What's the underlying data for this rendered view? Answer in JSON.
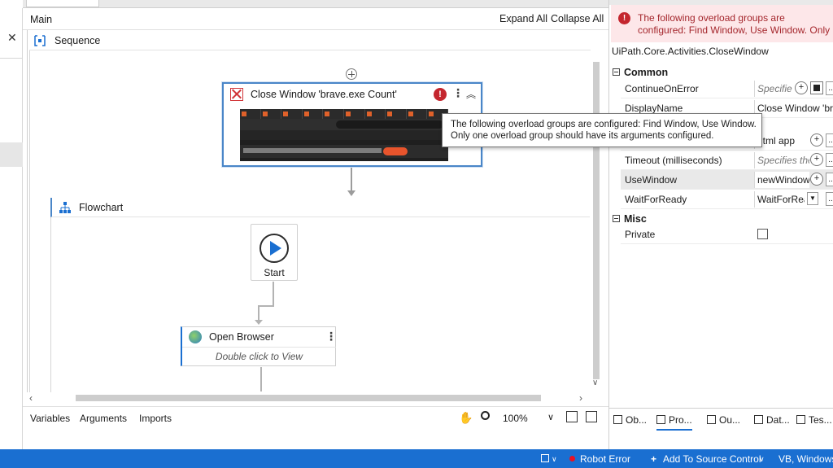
{
  "designer": {
    "breadcrumb": "Main",
    "expand_all": "Expand All",
    "collapse_all": "Collapse All",
    "sequence_label": "Sequence",
    "flowchart_label": "Flowchart"
  },
  "close_window": {
    "title": "Close Window 'brave.exe Count'"
  },
  "flowchart": {
    "start_label": "Start",
    "open_browser_title": "Open Browser",
    "open_browser_hint": "Double click to View"
  },
  "tooltip": {
    "text": "The following overload groups are configured: Find Window, Use Window. Only one overload group should have its arguments configured."
  },
  "footer": {
    "variables": "Variables",
    "arguments": "Arguments",
    "imports": "Imports",
    "zoom": "100%"
  },
  "properties": {
    "error_text": "The following overload groups are configured: Find Window, Use Window. Only one overlo...",
    "type_name": "UiPath.Core.Activities.CloseWindow",
    "categories": {
      "common": "Common",
      "misc": "Misc"
    },
    "rows": {
      "continue_on_error": {
        "name": "ContinueOnError",
        "value": "Specifie"
      },
      "display_name": {
        "name": "DisplayName",
        "value": "Close Window 'brav"
      },
      "row3_value": "html app",
      "timeout": {
        "name": "Timeout (milliseconds)",
        "value": "Specifies the"
      },
      "use_window": {
        "name": "UseWindow",
        "value": "newWindow"
      },
      "wait_for_ready": {
        "name": "WaitForReady",
        "value": "WaitForRea"
      },
      "private": {
        "name": "Private"
      }
    },
    "tabs": [
      "Ob...",
      "Pro...",
      "Ou...",
      "Dat...",
      "Tes..."
    ]
  },
  "statusbar": {
    "robot_error": "Robot Error",
    "source_control": "Add To Source Control",
    "language": "VB, Windows"
  },
  "colors": {
    "accent": "#1a6fd1",
    "error": "#c4262e",
    "error_bg": "#fde7e9"
  }
}
